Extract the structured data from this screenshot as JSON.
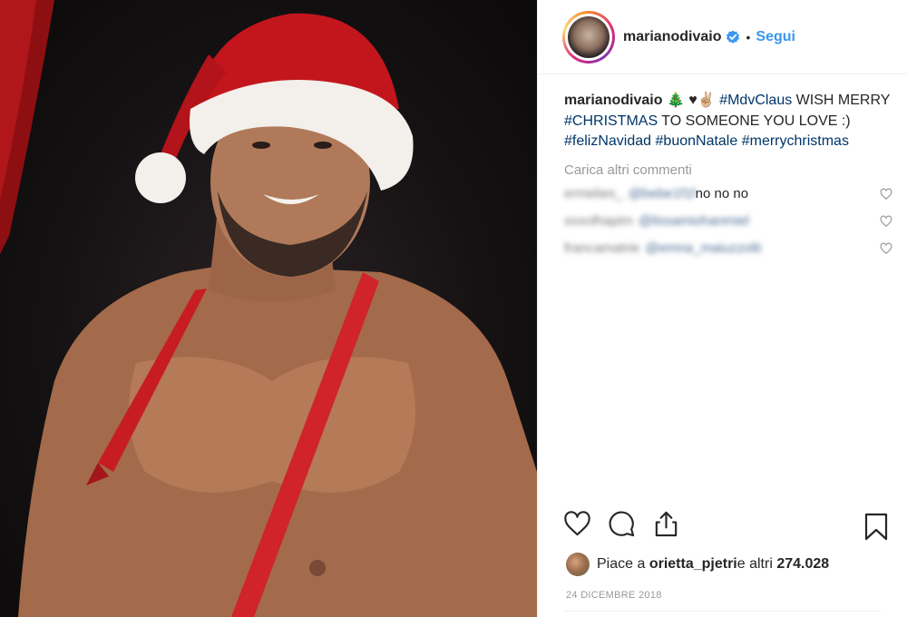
{
  "post": {
    "photo_alt": "Santa hat portrait"
  },
  "header": {
    "username": "marianodivaio",
    "separator": "•",
    "follow_label": "Segui"
  },
  "caption": {
    "username": "marianodivaio",
    "emoji": "🎄 ♥✌🏼",
    "parts": [
      {
        "text": " ",
        "tag": false
      },
      {
        "text": "#MdvClaus",
        "tag": true
      },
      {
        "text": " WISH MERRY ",
        "tag": false
      },
      {
        "text": "#CHRISTMAS",
        "tag": true
      },
      {
        "text": " TO SOMEONE YOU LOVE :) ",
        "tag": false
      },
      {
        "text": "#felizNavidad",
        "tag": true
      },
      {
        "text": " ",
        "tag": false
      },
      {
        "text": "#buonNatale",
        "tag": true
      },
      {
        "text": " ",
        "tag": false
      },
      {
        "text": "#merrychristmas",
        "tag": true
      }
    ]
  },
  "load_more": "Carica altri commenti",
  "comments": [
    {
      "user": "ermelies_",
      "mention": "@bebe1f1f",
      "text": " no no no"
    },
    {
      "user": "xoxolhapim",
      "mention": "@lissamiohanmiel",
      "text": ""
    },
    {
      "user": "francamatrie",
      "mention": "@emna_maiuzzolti",
      "text": ""
    }
  ],
  "likes": {
    "prefix": "Piace a ",
    "user": "orietta_pjetri",
    "middle": " e altri ",
    "count": "274.028"
  },
  "date": "24 DICEMBRE 2018",
  "colors": {
    "link": "#003569",
    "accent": "#3897f0",
    "muted": "#999999"
  }
}
